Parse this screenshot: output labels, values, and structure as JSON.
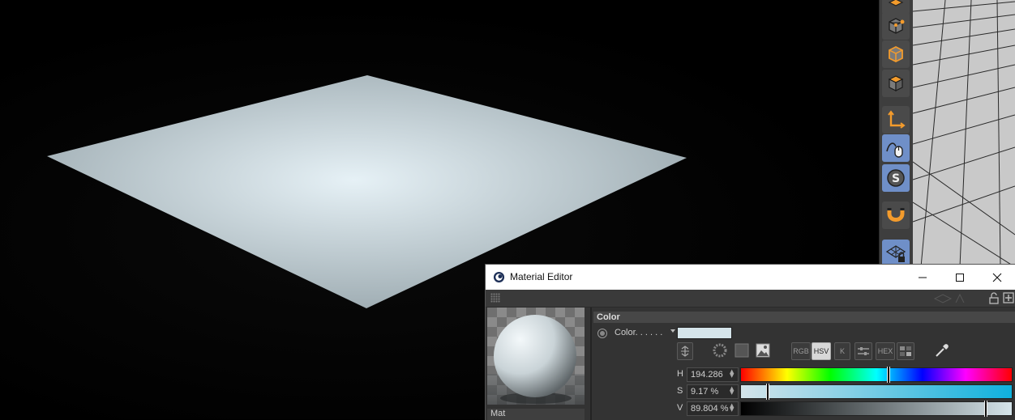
{
  "scene": {
    "plane_color_center": "#e6f1f6",
    "plane_color_edge": "#9aa8ae"
  },
  "toolbar": {
    "tools": [
      {
        "name": "points-mode-icon",
        "active": false
      },
      {
        "name": "edges-mode-icon",
        "active": false
      },
      {
        "name": "polygons-mode-icon",
        "active": false
      },
      {
        "name": "axis-icon",
        "active": false
      },
      {
        "name": "tweak-mode-icon",
        "active": true
      },
      {
        "name": "solo-icon",
        "active": true
      },
      {
        "name": "snap-magnet-icon",
        "active": false
      },
      {
        "name": "workplane-lock-icon",
        "active": true
      }
    ]
  },
  "material_editor": {
    "title": "Material Editor",
    "material_name": "Mat",
    "section_title": "Color",
    "color_label": "Color. . . . . .",
    "swatch_color": "#d5e4ea",
    "modes": [
      "RGB",
      "HSV",
      "K",
      "HEX"
    ],
    "active_mode": "HSV",
    "h": {
      "label": "H",
      "value": "194.286",
      "fraction": 0.54
    },
    "s": {
      "label": "S",
      "value": "9.17 %",
      "fraction": 0.0917
    },
    "v": {
      "label": "V",
      "value": "89.804 %",
      "fraction": 0.898
    },
    "accent_hue_color": "#0fb1dd"
  }
}
